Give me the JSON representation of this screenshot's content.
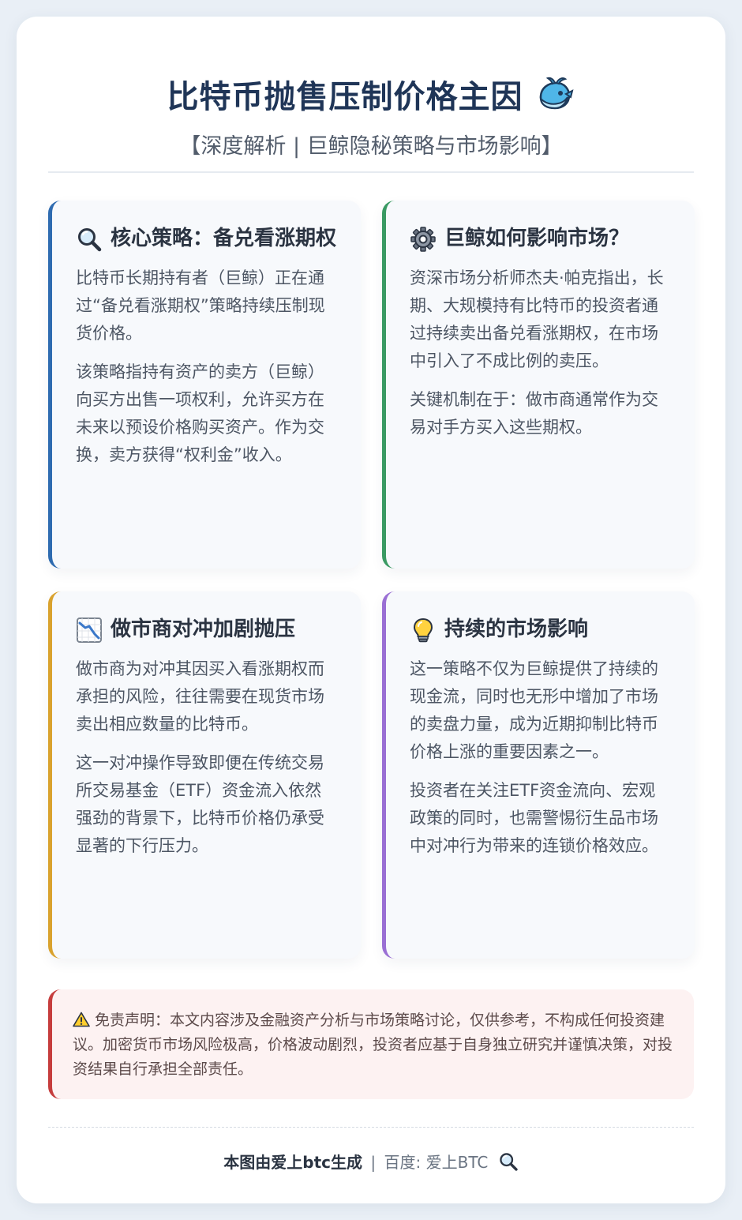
{
  "header": {
    "title": "比特币抛售压制价格主因",
    "title_icon": "whale-icon",
    "subtitle": "【深度解析 | 巨鲸隐秘策略与市场影响】"
  },
  "cards": [
    {
      "icon": "magnifier-icon",
      "accent": "#2e6bb0",
      "title": "核心策略：备兑看涨期权",
      "paragraphs": [
        "比特币长期持有者（巨鲸）正在通过“备兑看涨期权”策略持续压制现货价格。",
        "该策略指持有资产的卖方（巨鲸）向买方出售一项权利，允许买方在未来以预设价格购买资产。作为交换，卖方获得“权利金”收入。"
      ]
    },
    {
      "icon": "gear-icon",
      "accent": "#3a9a63",
      "title": "巨鲸如何影响市场？",
      "paragraphs": [
        "资深市场分析师杰夫·帕克指出，长期、大规模持有比特币的投资者通过持续卖出备兑看涨期权，在市场中引入了不成比例的卖压。",
        "关键机制在于：做市商通常作为交易对手方买入这些期权。"
      ]
    },
    {
      "icon": "chart-down-icon",
      "accent": "#d9a22e",
      "title": "做市商对冲加剧抛压",
      "paragraphs": [
        "做市商为对冲其因买入看涨期权而承担的风险，往往需要在现货市场卖出相应数量的比特币。",
        "这一对冲操作导致即便在传统交易所交易基金（ETF）资金流入依然强劲的背景下，比特币价格仍承受显著的下行压力。"
      ]
    },
    {
      "icon": "lightbulb-icon",
      "accent": "#9a6fd4",
      "title": "持续的市场影响",
      "paragraphs": [
        "这一策略不仅为巨鲸提供了持续的现金流，同时也无形中增加了市场的卖盘力量，成为近期抑制比特币价格上涨的重要因素之一。",
        "投资者在关注ETF资金流向、宏观政策的同时，也需警惕衍生品市场中对冲行为带来的连锁价格效应。"
      ]
    }
  ],
  "disclaimer": {
    "icon": "warning-icon",
    "text": "免责声明：本文内容涉及金融资产分析与市场策略讨论，仅供参考，不构成任何投资建议。加密货币市场风险极高，价格波动剧烈，投资者应基于自身独立研究并谨慎决策，对投资结果自行承担全部责任。"
  },
  "footer": {
    "brand": "本图由爱上btc生成",
    "separator": "|",
    "search_text": "百度: 爱上BTC",
    "icon": "magnifier-icon"
  }
}
